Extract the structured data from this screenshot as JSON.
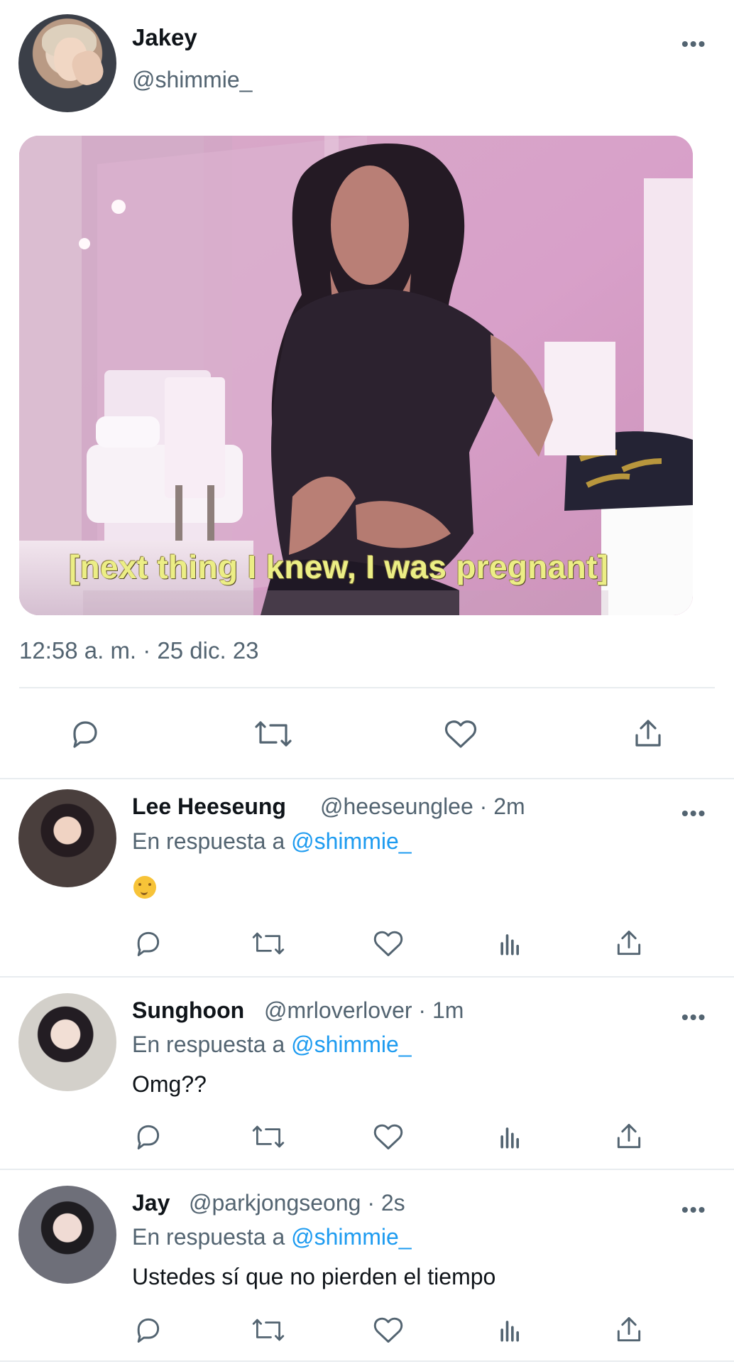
{
  "tweet": {
    "author_name": "Jakey",
    "author_handle": "@shimmie_",
    "image_caption": "[next thing I knew, I was pregnant]",
    "timestamp": "12:58 a. m. · 25 dic. 23"
  },
  "replies": [
    {
      "name": "Lee Heeseung",
      "meta": "@heeseunglee · 2m",
      "reply_prefix": "En respuesta a",
      "reply_handle": "@shimmie_",
      "text": "",
      "emoji": "face-with-hand-over-mouth"
    },
    {
      "name": "Sunghoon",
      "meta": "@mrloverlover · 1m",
      "reply_prefix": "En respuesta a",
      "reply_handle": "@shimmie_",
      "text": "Omg??"
    },
    {
      "name": "Jay",
      "meta": "@parkjongseong · 2s",
      "reply_prefix": "En respuesta a",
      "reply_handle": "@shimmie_",
      "text": "Ustedes sí que no pierden el tiempo"
    }
  ],
  "icons": {
    "more": "more-options-icon",
    "reply": "reply-icon",
    "retweet": "retweet-icon",
    "like": "like-icon",
    "views": "views-icon",
    "share": "share-icon"
  },
  "colors": {
    "link": "#1d9bf0",
    "secondary_text": "#536471",
    "divider": "#e8ecef",
    "caption_text": "#ecee85"
  }
}
